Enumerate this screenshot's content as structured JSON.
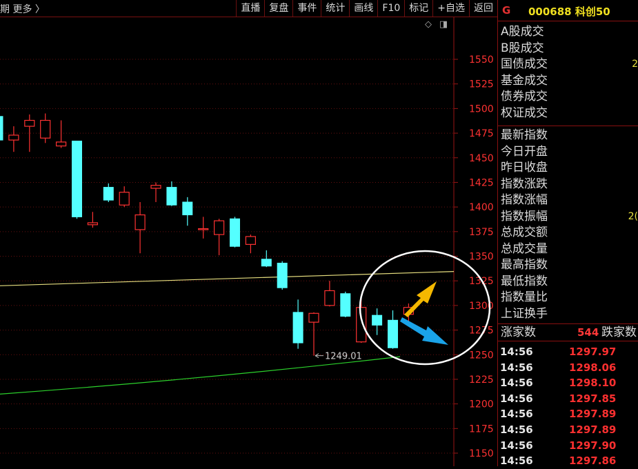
{
  "topbar": {
    "left_text": "期  更多 〉",
    "menu": [
      "直播",
      "复盘",
      "事件",
      "统计",
      "画线",
      "F10",
      "标记",
      "+自选",
      "返回"
    ]
  },
  "colors": {
    "up": "#ff3232",
    "down": "#54ffff",
    "ma_yellow": "#e8e080",
    "ma_green": "#2cd32c",
    "arrow_up": "#f5b800",
    "arrow_down": "#1aa3e8"
  },
  "chart": {
    "y_ticks": [
      1550,
      1525,
      1500,
      1475,
      1450,
      1425,
      1400,
      1375,
      1350,
      1325,
      1300,
      1275,
      1250,
      1225,
      1200,
      1175,
      1150
    ],
    "low_label": "1249.01",
    "low_value": 1249.01,
    "candles": [
      {
        "o": 1492,
        "c": 1468,
        "h": 1494,
        "l": 1466
      },
      {
        "o": 1468,
        "c": 1473,
        "h": 1482,
        "l": 1456
      },
      {
        "o": 1482,
        "c": 1488,
        "h": 1494,
        "l": 1456
      },
      {
        "o": 1470,
        "c": 1488,
        "h": 1495,
        "l": 1465
      },
      {
        "o": 1462,
        "c": 1466,
        "h": 1488,
        "l": 1460
      },
      {
        "o": 1467,
        "c": 1390,
        "h": 1467,
        "l": 1388
      },
      {
        "o": 1382,
        "c": 1384,
        "h": 1395,
        "l": 1379
      },
      {
        "o": 1420,
        "c": 1407,
        "h": 1424,
        "l": 1405
      },
      {
        "o": 1402,
        "c": 1415,
        "h": 1421,
        "l": 1400
      },
      {
        "o": 1377,
        "c": 1392,
        "h": 1405,
        "l": 1353
      },
      {
        "o": 1419,
        "c": 1422,
        "h": 1425,
        "l": 1405
      },
      {
        "o": 1420,
        "c": 1402,
        "h": 1426,
        "l": 1401
      },
      {
        "o": 1405,
        "c": 1392,
        "h": 1410,
        "l": 1381
      },
      {
        "o": 1378,
        "c": 1378,
        "h": 1390,
        "l": 1368
      },
      {
        "o": 1372,
        "c": 1386,
        "h": 1388,
        "l": 1351
      },
      {
        "o": 1388,
        "c": 1360,
        "h": 1390,
        "l": 1359
      },
      {
        "o": 1362,
        "c": 1370,
        "h": 1372,
        "l": 1353
      },
      {
        "o": 1347,
        "c": 1340,
        "h": 1356,
        "l": 1339
      },
      {
        "o": 1343,
        "c": 1318,
        "h": 1345,
        "l": 1316
      },
      {
        "o": 1293,
        "c": 1262,
        "h": 1306,
        "l": 1256
      },
      {
        "o": 1283,
        "c": 1292,
        "h": 1293,
        "l": 1249.01
      },
      {
        "o": 1300,
        "c": 1315,
        "h": 1325,
        "l": 1299
      },
      {
        "o": 1312,
        "c": 1289,
        "h": 1314,
        "l": 1288
      },
      {
        "o": 1263,
        "c": 1298,
        "h": 1307,
        "l": 1262
      },
      {
        "o": 1290,
        "c": 1280,
        "h": 1297,
        "l": 1270
      },
      {
        "o": 1285,
        "c": 1257,
        "h": 1295,
        "l": 1256
      },
      {
        "o": 1291,
        "c": 1298,
        "h": 1302,
        "l": 1283
      }
    ],
    "ma_yellow": [
      1320,
      1334.5
    ],
    "ma_green": [
      1210,
      1248
    ]
  },
  "right": {
    "code": "000688",
    "name": "科创50",
    "g_label": "G",
    "volume_rows": [
      {
        "label": "A股成交",
        "value": ""
      },
      {
        "label": "B股成交",
        "value": ""
      },
      {
        "label": "国债成交",
        "value": "2"
      },
      {
        "label": "基金成交",
        "value": ""
      },
      {
        "label": "债券成交",
        "value": ""
      },
      {
        "label": "权证成交",
        "value": ""
      }
    ],
    "index_rows": [
      {
        "label": "最新指数",
        "value": ""
      },
      {
        "label": "今日开盘",
        "value": ""
      },
      {
        "label": "昨日收盘",
        "value": ""
      },
      {
        "label": "指数涨跌",
        "value": ""
      },
      {
        "label": "指数涨幅",
        "value": ""
      },
      {
        "label": "指数振幅",
        "value": "2("
      },
      {
        "label": "总成交额",
        "value": ""
      },
      {
        "label": "总成交量",
        "value": ""
      },
      {
        "label": "最高指数",
        "value": ""
      },
      {
        "label": "最低指数",
        "value": ""
      },
      {
        "label": "指数量比",
        "value": ""
      },
      {
        "label": "上证换手",
        "value": ""
      }
    ],
    "up_label": "涨家数",
    "up_count": "544",
    "down_label": "跌家数",
    "ticks": [
      {
        "time": "14:56",
        "price": "1297.97"
      },
      {
        "time": "14:56",
        "price": "1298.06"
      },
      {
        "time": "14:56",
        "price": "1298.10"
      },
      {
        "time": "14:56",
        "price": "1297.85"
      },
      {
        "time": "14:56",
        "price": "1297.89"
      },
      {
        "time": "14:56",
        "price": "1297.89"
      },
      {
        "time": "14:56",
        "price": "1297.90"
      },
      {
        "time": "14:56",
        "price": "1297.86"
      }
    ]
  }
}
